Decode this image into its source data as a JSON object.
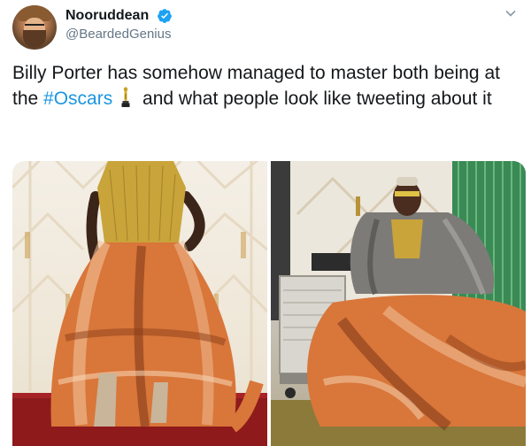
{
  "tweet": {
    "author": {
      "display_name": "Nooruddean",
      "handle": "@BeardedGenius",
      "verified": true,
      "avatar_icon": "avatar-photo"
    },
    "menu_icon": "chevron-down-icon",
    "text_parts": {
      "part1": "Billy Porter has somehow managed to master both being at the ",
      "hashtag": "#Oscars",
      "emoji_icon": "oscar-trophy-icon",
      "part2": " and what people look like tweeting about it"
    },
    "media": [
      {
        "name": "photo-left",
        "description_icon": "oscars-gown-photo"
      },
      {
        "name": "photo-right",
        "description_icon": "seated-blanket-photo"
      }
    ]
  },
  "colors": {
    "text": "#14171a",
    "secondary": "#657786",
    "link": "#1b95e0",
    "verified": "#1da1f2"
  }
}
